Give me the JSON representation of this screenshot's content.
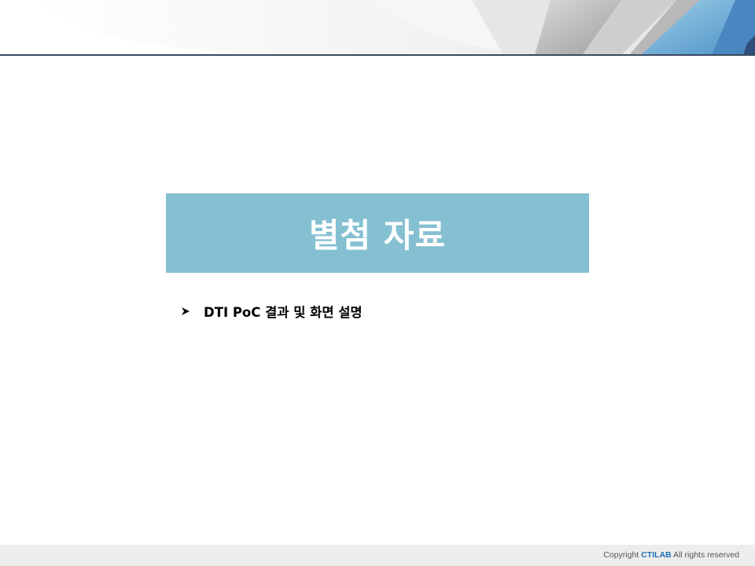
{
  "slide": {
    "title": "별첨 자료",
    "bullets": [
      {
        "text": "DTI PoC 결과 및 화면 설명",
        "icon": "arrow-bullet-icon"
      }
    ]
  },
  "footer": {
    "copyright_prefix": "Copyright ",
    "brand": "CTILAB",
    "copyright_suffix": " All rights reserved"
  },
  "colors": {
    "title_box": "#85c0d2",
    "title_text": "#ffffff",
    "header_rule": "#3a4a63",
    "accent_blue": "#5b9ed1",
    "brand": "#1f6fb3",
    "footer_bg": "#ededed"
  }
}
